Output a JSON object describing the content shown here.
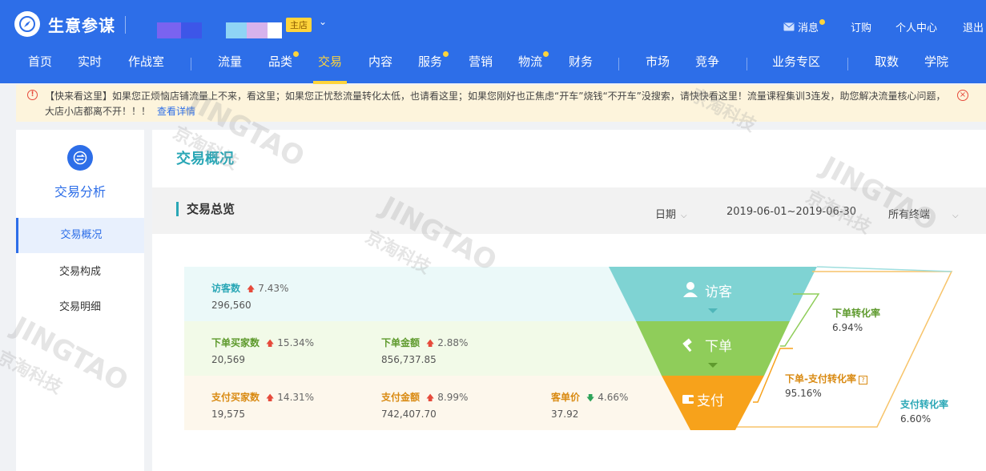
{
  "header": {
    "brand": "生意参谋",
    "shop_tag": "主店",
    "messages": "消息",
    "subscribe": "订购",
    "personal_center": "个人中心",
    "logout": "退出"
  },
  "nav": {
    "items": [
      "首页",
      "实时",
      "作战室",
      "流量",
      "品类",
      "交易",
      "内容",
      "服务",
      "营销",
      "物流",
      "财务",
      "市场",
      "竞争",
      "业务专区",
      "取数",
      "学院"
    ]
  },
  "notice": {
    "text": "【快来看这里】如果您正烦恼店铺流量上不来，看这里；如果您正忧愁流量转化太低，也请看这里；如果您刚好也正焦虑“开车”烧钱“不开车”没搜索，请快快看这里！流量课程集训3连发，助您解决流量核心问题，大店小店都离不开！！！",
    "link": "查看详情"
  },
  "sidebar": {
    "title": "交易分析",
    "items": [
      "交易概况",
      "交易构成",
      "交易明细"
    ]
  },
  "main": {
    "page_title": "交易概况",
    "summary_title": "交易总览",
    "filter_period": "日期",
    "date_range": "2019-06-01~2019-06-30",
    "terminal": "所有终端"
  },
  "funnel": {
    "visitors": {
      "label": "访客数",
      "change": "7.43%",
      "value": "296,560"
    },
    "order_buyers": {
      "label": "下单买家数",
      "change": "15.34%",
      "value": "20,569"
    },
    "order_amount": {
      "label": "下单金额",
      "change": "2.88%",
      "value": "856,737.85"
    },
    "pay_buyers": {
      "label": "支付买家数",
      "change": "14.31%",
      "value": "19,575"
    },
    "pay_amount": {
      "label": "支付金额",
      "change": "8.99%",
      "value": "742,407.70"
    },
    "avg_price": {
      "label": "客单价",
      "change": "4.66%",
      "value": "37.92"
    },
    "stage_labels": [
      "访客",
      "下单",
      "支付"
    ],
    "stage_colors": [
      "#7fd3d3",
      "#8fcd5a",
      "#f7a21b"
    ],
    "order_conversion": {
      "label": "下单转化率",
      "value": "6.94%"
    },
    "order_pay_conversion": {
      "label": "下单-支付转化率",
      "value": "95.16%"
    },
    "pay_conversion": {
      "label": "支付转化率",
      "value": "6.60%"
    }
  },
  "watermark": {
    "brand": "JINGTAO",
    "cn": "京淘科技"
  }
}
